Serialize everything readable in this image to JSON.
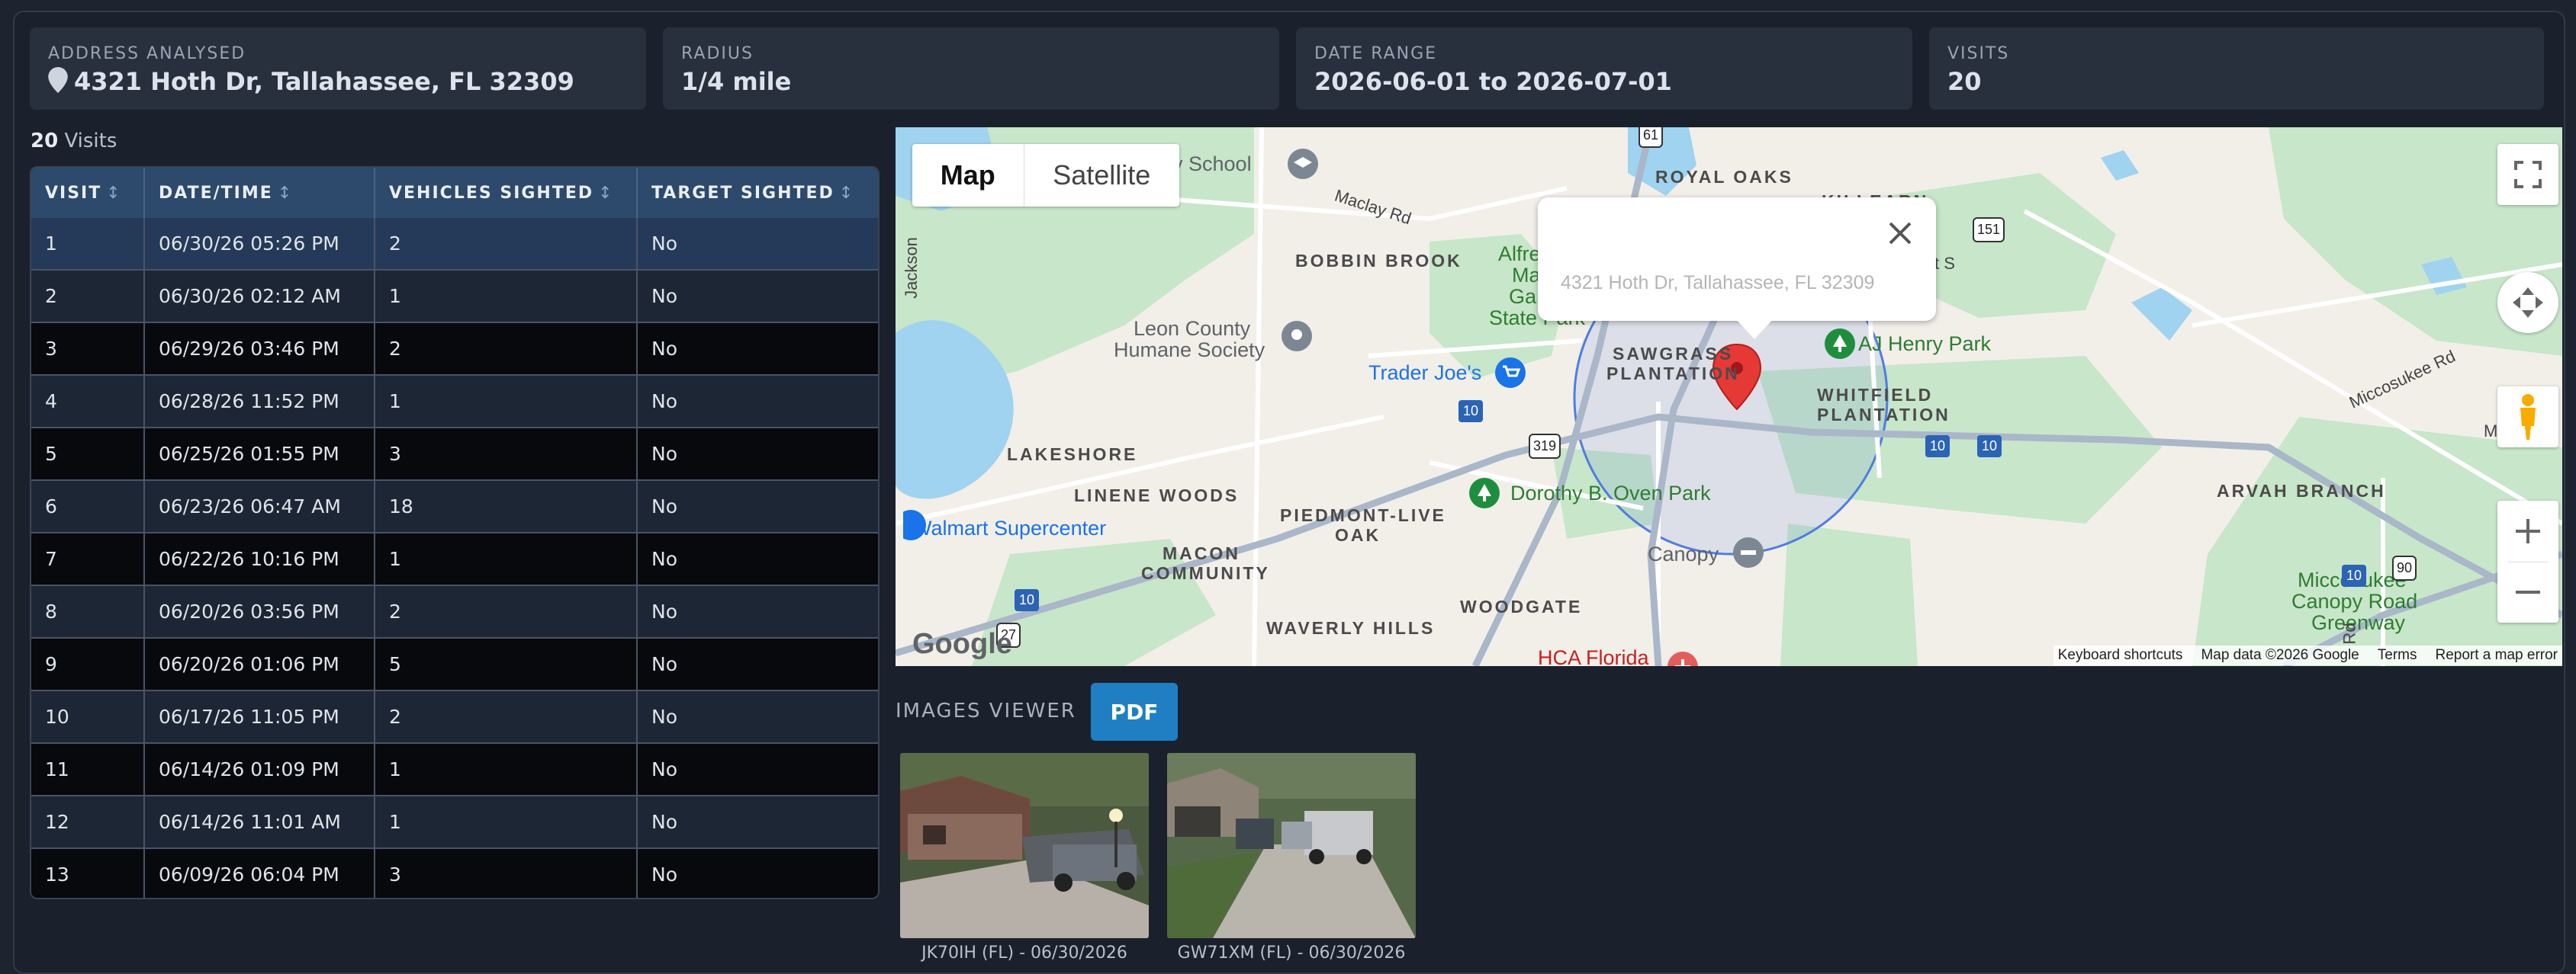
{
  "summary": {
    "address": {
      "label": "ADDRESS ANALYSED",
      "value": "4321 Hoth Dr, Tallahassee, FL 32309"
    },
    "radius": {
      "label": "RADIUS",
      "value": "1/4 mile"
    },
    "date_range": {
      "label": "DATE RANGE",
      "value": "2026-06-01 to 2026-07-01"
    },
    "visits": {
      "label": "VISITS",
      "value": "20"
    }
  },
  "visits_count": {
    "number": "20",
    "suffix": " Visits"
  },
  "table": {
    "columns": [
      "VISIT",
      "DATE/TIME",
      "VEHICLES SIGHTED",
      "TARGET SIGHTED"
    ],
    "sort_glyph": "↕",
    "rows": [
      [
        "1",
        "06/30/26 05:26 PM",
        "2",
        "No"
      ],
      [
        "2",
        "06/30/26 02:12 AM",
        "1",
        "No"
      ],
      [
        "3",
        "06/29/26 03:46 PM",
        "2",
        "No"
      ],
      [
        "4",
        "06/28/26 11:52 PM",
        "1",
        "No"
      ],
      [
        "5",
        "06/25/26 01:55 PM",
        "3",
        "No"
      ],
      [
        "6",
        "06/23/26 06:47 AM",
        "18",
        "No"
      ],
      [
        "7",
        "06/22/26 10:16 PM",
        "1",
        "No"
      ],
      [
        "8",
        "06/20/26 03:56 PM",
        "2",
        "No"
      ],
      [
        "9",
        "06/20/26 01:06 PM",
        "5",
        "No"
      ],
      [
        "10",
        "06/17/26 11:05 PM",
        "2",
        "No"
      ],
      [
        "11",
        "06/14/26 01:09 PM",
        "1",
        "No"
      ],
      [
        "12",
        "06/14/26 11:01 AM",
        "1",
        "No"
      ],
      [
        "13",
        "06/09/26 06:04 PM",
        "3",
        "No"
      ]
    ]
  },
  "map": {
    "type_map": "Map",
    "type_satellite": "Satellite",
    "popup_address": "4321 Hoth Dr, Tallahassee, FL 32309",
    "labels": {
      "royal_oaks": "ROYAL OAKS",
      "killearn": "KILLEARN",
      "bobbin_brook": "BOBBIN BROOK",
      "sawgrass": "SAWGRASS",
      "plantation": "PLANTATION",
      "whitfield": "WHITFIELD",
      "whitfield2": "PLANTATION",
      "lakeshore": "LAKESHORE",
      "linene_woods": "LINENE WOODS",
      "piedmont": "PIEDMONT-LIVE",
      "oak": "OAK",
      "macon": "MACON",
      "community": "COMMUNITY",
      "waverly": "WAVERLY HILLS",
      "woodgate": "WOODGATE",
      "arvah": "ARVAH BRANCH"
    },
    "pois": {
      "school": "ay School",
      "alfred1": "Alfre",
      "alfred2": "Ma",
      "alfred3": "Gar",
      "alfred4": "State Park",
      "humane1": "Leon County",
      "humane2": "Humane Society",
      "trader": "Trader Joe's",
      "ajhenry": "AJ Henry Park",
      "dorothy": "Dorothy B. Oven Park",
      "walmart": "Walmart Supercenter",
      "canopy": "Canopy",
      "miccosukee1": "Miccosukee",
      "miccosukee2": "Canopy Road",
      "miccosukee3": "Greenway",
      "hca": "HCA Florida",
      "maclay": "Maclay Rd",
      "miccosukee_rd": "Miccosukee Rd",
      "miles": "Miles Jo",
      "jackson": "Jackson",
      "st": "t S",
      "rd": "Rd"
    },
    "shields": {
      "i10": "10",
      "us319": "319",
      "us27": "27",
      "us90": "90",
      "r151": "151",
      "r61": "61"
    },
    "google": "Google",
    "attribution": [
      "Keyboard shortcuts",
      "Map data ©2026 Google",
      "Terms",
      "Report a map error"
    ]
  },
  "images_viewer": {
    "label": "IMAGES VIEWER",
    "pdf": "PDF",
    "captions": [
      "JK70IH (FL) - 06/30/2026",
      "GW71XM (FL) - 06/30/2026"
    ]
  },
  "colors": {
    "header": "#2d4a6c",
    "accent": "#1f7fc2",
    "selected_row": "#243a58",
    "pin": "#e53935"
  }
}
